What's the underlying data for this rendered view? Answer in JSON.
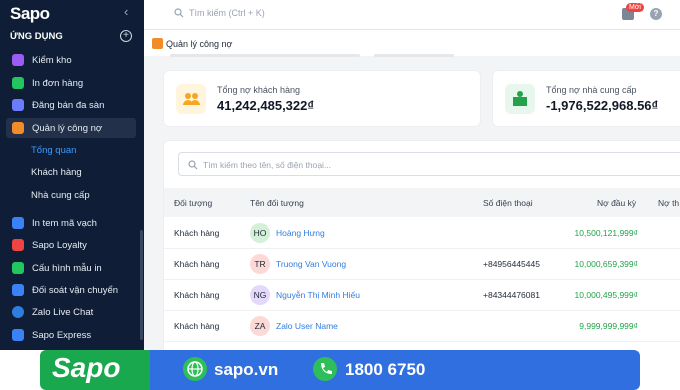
{
  "sidebar": {
    "logo": "Sapo",
    "collapse_icon": "‹",
    "section_title": "ỨNG DỤNG",
    "items": [
      {
        "label": "Kiểm kho",
        "icon": "inventory-icon",
        "color": "#9b5cf6"
      },
      {
        "label": "In đơn hàng",
        "icon": "print-order-icon",
        "color": "#22c55e"
      },
      {
        "label": "Đăng bán đa sàn",
        "icon": "multichannel-icon",
        "color": "#6b7cff"
      },
      {
        "label": "Quản lý công nợ",
        "icon": "debt-icon",
        "color": "#f28c28"
      },
      {
        "label": "In tem mã vạch",
        "icon": "barcode-icon",
        "color": "#3b82f6"
      },
      {
        "label": "Sapo Loyalty",
        "icon": "loyalty-icon",
        "color": "#ef4444"
      },
      {
        "label": "Cấu hình mẫu in",
        "icon": "print-template-icon",
        "color": "#22c55e"
      },
      {
        "label": "Đối soát vận chuyển",
        "icon": "shipping-icon",
        "color": "#3b82f6"
      },
      {
        "label": "Zalo Live Chat",
        "icon": "zalo-icon",
        "color": "#2f7de1"
      },
      {
        "label": "Sapo Express",
        "icon": "express-icon",
        "color": "#3b82f6"
      }
    ],
    "sub_items": [
      {
        "label": "Tổng quan",
        "active": true
      },
      {
        "label": "Khách hàng",
        "active": false
      },
      {
        "label": "Nhà cung cấp",
        "active": false
      }
    ]
  },
  "topbar": {
    "search_placeholder": "Tìm kiếm (Ctrl + K)",
    "badge": "Mới",
    "help": "?"
  },
  "tab": {
    "label": "Quản lý công nợ"
  },
  "cards": [
    {
      "label": "Tổng nợ khách hàng",
      "value": "41,242,485,322₫",
      "color": "#fff4dc",
      "icon": "customers-icon"
    },
    {
      "label": "Tổng nợ nhà cung cấp",
      "value": "-1,976,522,968.56₫",
      "color": "#e7f7ee",
      "icon": "supplier-icon"
    }
  ],
  "table": {
    "search_placeholder": "Tìm kiếm theo tên, số điện thoại...",
    "headers": [
      "Đối tượng",
      "Tên đối tượng",
      "Số điện thoại",
      "Nợ đầu kỳ",
      "Nợ th"
    ],
    "rows": [
      {
        "type": "Khách hàng",
        "initials": "HO",
        "avatar_color": "#d5f0d8",
        "name": "Hoàng Hưng",
        "phone": "",
        "debt": "10,500,121,999₫"
      },
      {
        "type": "Khách hàng",
        "initials": "TR",
        "avatar_color": "#fcd9d6",
        "name": "Truong Van Vuong",
        "phone": "+84956445445",
        "debt": "10,000,659,399₫"
      },
      {
        "type": "Khách hàng",
        "initials": "NG",
        "avatar_color": "#e5d9fb",
        "name": "Nguyễn Thị Minh Hiếu",
        "phone": "+84344476081",
        "debt": "10,000,495,999₫"
      },
      {
        "type": "Khách hàng",
        "initials": "ZA",
        "avatar_color": "#fcd9d6",
        "name": "Zalo User Name",
        "phone": "",
        "debt": "9,999,999,999₫"
      }
    ]
  },
  "banner": {
    "logo": "Sapo",
    "website": "sapo.vn",
    "phone": "1800 6750"
  }
}
